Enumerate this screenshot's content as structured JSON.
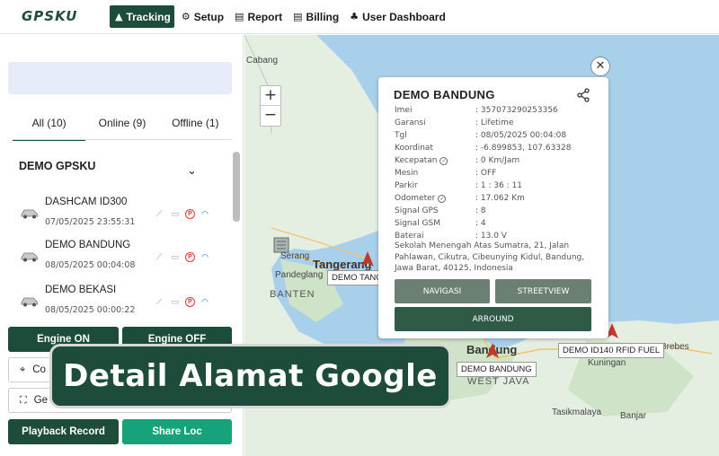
{
  "logo": {
    "text": "GPSKU"
  },
  "nav": {
    "tracking": "Tracking",
    "setup": "Setup",
    "report": "Report",
    "billing": "Billing",
    "user_dashboard": "User Dashboard"
  },
  "sidebar": {
    "tabs": [
      "All (10)",
      "Online (9)",
      "Offline (1)"
    ],
    "group_title": "DEMO GPSKU",
    "devices": [
      {
        "name": "DASHCAM ID300",
        "time": "07/05/2025 23:55:31"
      },
      {
        "name": "DEMO BANDUNG",
        "time": "08/05/2025 00:04:08"
      },
      {
        "name": "DEMO BEKASI",
        "time": "08/05/2025 00:00:22"
      }
    ],
    "buttons": {
      "engine_on": "Engine ON",
      "engine_off": "Engine OFF",
      "center": "Co",
      "geofence": "Ge",
      "playback": "Playback Record",
      "share_loc": "Share Loc"
    }
  },
  "map": {
    "labels": {
      "cabang": "Cabang",
      "serang": "Serang",
      "tangerang": "Tangerang",
      "pandeglang": "Pandeglang",
      "banten": "BANTEN",
      "bandung": "Bandung",
      "west_java": "WEST JAVA",
      "kuningan": "Kuningan",
      "brebes": "Brebes",
      "tasikmalaya": "Tasikmalaya",
      "banjar": "Banjar"
    },
    "pins": {
      "demo_tang": "DEMO TANG",
      "demo_bandung": "DEMO BANDUNG",
      "demo_id140": "DEMO ID140 RFID FUEL"
    }
  },
  "popup": {
    "title": "DEMO BANDUNG",
    "rows": [
      {
        "label": "Imei",
        "value": ": 357073290253356"
      },
      {
        "label": "Garansi",
        "value": ": Lifetime"
      },
      {
        "label": "Tgl",
        "value": ": 08/05/2025 00:04:08"
      },
      {
        "label": "Koordinat",
        "value": ": -6.899853, 107.63328"
      },
      {
        "label": "Kecepatan",
        "value": ": 0 Km/Jam"
      },
      {
        "label": "Mesin",
        "value": ": OFF"
      },
      {
        "label": "Parkir",
        "value": ": 1 : 36 : 11"
      },
      {
        "label": "Odometer",
        "value": ": 17.062 Km"
      },
      {
        "label": "Signal GPS",
        "value": ": 8"
      },
      {
        "label": "Signal GSM",
        "value": ": 4"
      },
      {
        "label": "Baterai",
        "value": ": 13.0 V"
      }
    ],
    "address": "Sekolah Menengah Atas Sumatra, 21, Jalan Pahlawan, Cikutra, Cibeunying Kidul, Bandung, Jawa Barat, 40125, Indonesia",
    "buttons": {
      "navigasi": "NAVIGASI",
      "streetview": "STREETVIEW",
      "arround": "ARROUND"
    }
  },
  "banner": {
    "text": "Detail Alamat Google"
  },
  "colors": {
    "brand": "#1d4d3a",
    "accent": "#16a37a",
    "alert": "#e53935",
    "signal": "#1976d2"
  }
}
